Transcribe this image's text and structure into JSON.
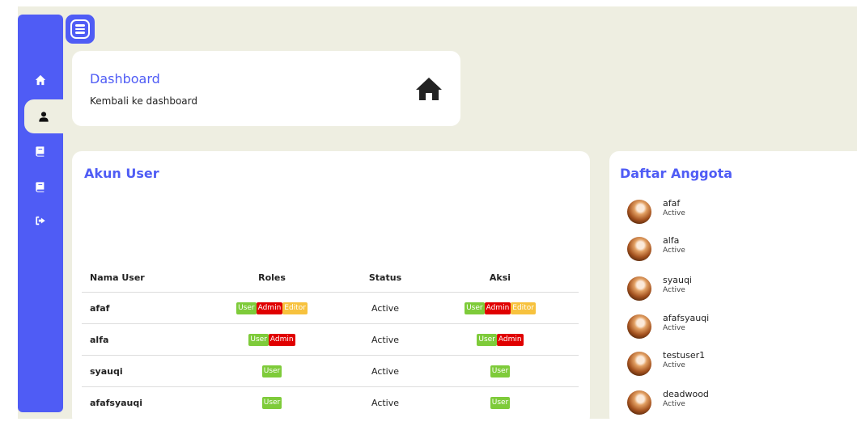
{
  "dashboard": {
    "title": "Dashboard",
    "subtitle": "Kembali ke dashboard"
  },
  "user_card": {
    "title": "Akun User",
    "columns": [
      "Nama User",
      "Roles",
      "Status",
      "Aksi"
    ],
    "rows": [
      {
        "name": "afaf",
        "roles": [
          "User",
          "Admin",
          "Editor"
        ],
        "status": "Active",
        "actions": [
          "User",
          "Admin",
          "Editor"
        ]
      },
      {
        "name": "alfa",
        "roles": [
          "User",
          "Admin"
        ],
        "status": "Active",
        "actions": [
          "User",
          "Admin"
        ]
      },
      {
        "name": "syauqi",
        "roles": [
          "User"
        ],
        "status": "Active",
        "actions": [
          "User"
        ]
      },
      {
        "name": "afafsyauqi",
        "roles": [
          "User"
        ],
        "status": "Active",
        "actions": [
          "User"
        ]
      }
    ]
  },
  "members": {
    "title": "Daftar Anggota",
    "items": [
      {
        "name": "afaf",
        "status": "Active"
      },
      {
        "name": "alfa",
        "status": "Active"
      },
      {
        "name": "syauqi",
        "status": "Active"
      },
      {
        "name": "afafsyauqi",
        "status": "Active"
      },
      {
        "name": "testuser1",
        "status": "Active"
      },
      {
        "name": "deadwood",
        "status": "Active"
      }
    ]
  },
  "sidebar": {
    "items": [
      {
        "icon": "home-icon"
      },
      {
        "icon": "user-icon",
        "active": true
      },
      {
        "icon": "book-icon"
      },
      {
        "icon": "book-icon"
      },
      {
        "icon": "logout-icon"
      }
    ]
  },
  "colors": {
    "accent": "#4f5cf5",
    "background": "#eeeee1",
    "user_badge": "#7ecb3a",
    "admin_badge": "#e00000",
    "editor_badge": "#f7c23e"
  }
}
